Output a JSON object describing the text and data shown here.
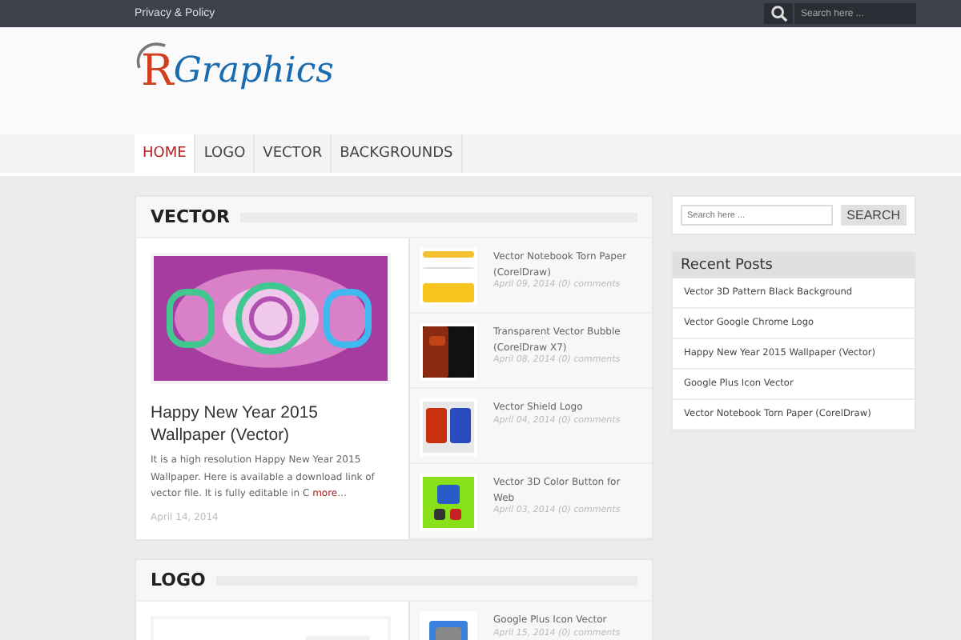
{
  "top_bar": {
    "link": "Privacy & Policy",
    "search": {
      "placeholder": "Search here ..."
    }
  },
  "logo": {
    "mark": "R",
    "text": "Graphics"
  },
  "nav": [
    {
      "label": "HOME",
      "selected": true
    },
    {
      "label": "LOGO",
      "selected": false
    },
    {
      "label": "VECTOR",
      "selected": false
    },
    {
      "label": "BACKGROUNDS",
      "selected": false
    }
  ],
  "sections": [
    {
      "title": "VECTOR",
      "featured": {
        "title": "Happy New Year 2015 Wallpaper (Vector)",
        "excerpt": "It is a high resolution Happy New Year 2015 Wallpaper. Here is available a download link of vector file. It is fully editable in C",
        "more": "more",
        "ellipsis": "...",
        "date": "April 14, 2014"
      },
      "posts": [
        {
          "title": "Vector Notebook Torn Paper (CorelDraw)",
          "meta": "April 09, 2014 (0) comments"
        },
        {
          "title": "Transparent Vector Bubble (CorelDraw X7)",
          "meta": "April 08, 2014 (0) comments"
        },
        {
          "title": "Vector Shield Logo",
          "meta": "April 04, 2014 (0) comments"
        },
        {
          "title": "Vector 3D Color Button for Web",
          "meta": "April 03, 2014 (0) comments"
        }
      ]
    },
    {
      "title": "LOGO",
      "posts": [
        {
          "title": "Google Plus Icon Vector",
          "meta": "April 15, 2014 (0) comments"
        }
      ]
    }
  ],
  "sidebar": {
    "search": {
      "placeholder": "Search here ...",
      "button": "SEARCH"
    },
    "recent": {
      "title": "Recent Posts",
      "items": [
        "Vector 3D Pattern Black Background",
        "Vector Google Chrome Logo",
        "Happy New Year 2015 Wallpaper (Vector)",
        "Google Plus Icon Vector",
        "Vector Notebook Torn Paper (CorelDraw)"
      ]
    }
  }
}
